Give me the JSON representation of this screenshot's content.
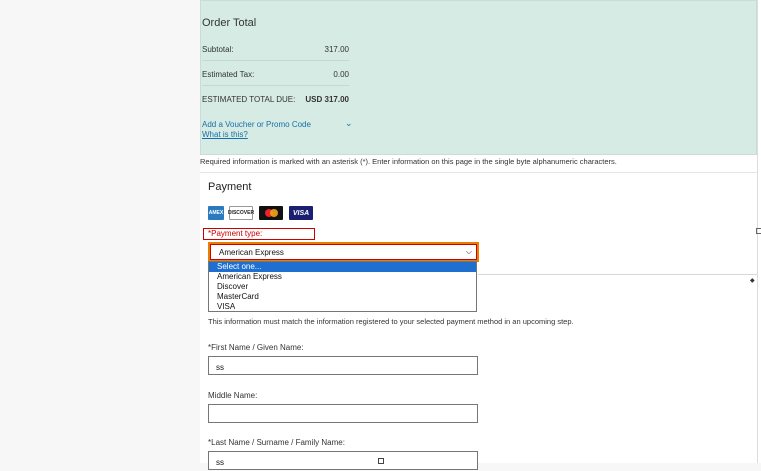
{
  "order_total": {
    "title": "Order Total",
    "subtotal_label": "Subtotal:",
    "subtotal_value": "317.00",
    "tax_label": "Estimated Tax:",
    "tax_value": "0.00",
    "total_label": "ESTIMATED TOTAL DUE:",
    "total_value": "USD 317.00",
    "voucher_link": "Add a Voucher or Promo Code",
    "whatis_link": "What is this?",
    "chevron_icon": "chevron-down-icon"
  },
  "required_note": "Required information is marked with an asterisk (*). Enter information on this page in the single byte alphanumeric characters.",
  "payment": {
    "title": "Payment",
    "cards": [
      "AMEX",
      "DISCOVER",
      "MasterCard",
      "VISA"
    ],
    "type_label": "*Payment type:",
    "selected_value": "American Express",
    "options": [
      "Select one...",
      "American Express",
      "Discover",
      "MasterCard",
      "VISA"
    ],
    "highlighted_option": "Select one..."
  },
  "info_note": "This information must match the information registered to your selected payment method in an upcoming step.",
  "fields": {
    "first_label": "*First Name / Given Name:",
    "first_value": "ss",
    "middle_label": "Middle Name:",
    "middle_value": "",
    "last_label": "*Last Name / Surname / Family Name:",
    "last_value": "ss"
  },
  "colors": {
    "panel_bg": "#d5ebe4",
    "link": "#1b6fa8",
    "error": "#cc0000",
    "focus": "#e87f00",
    "option_highlight": "#1e6fd0"
  }
}
